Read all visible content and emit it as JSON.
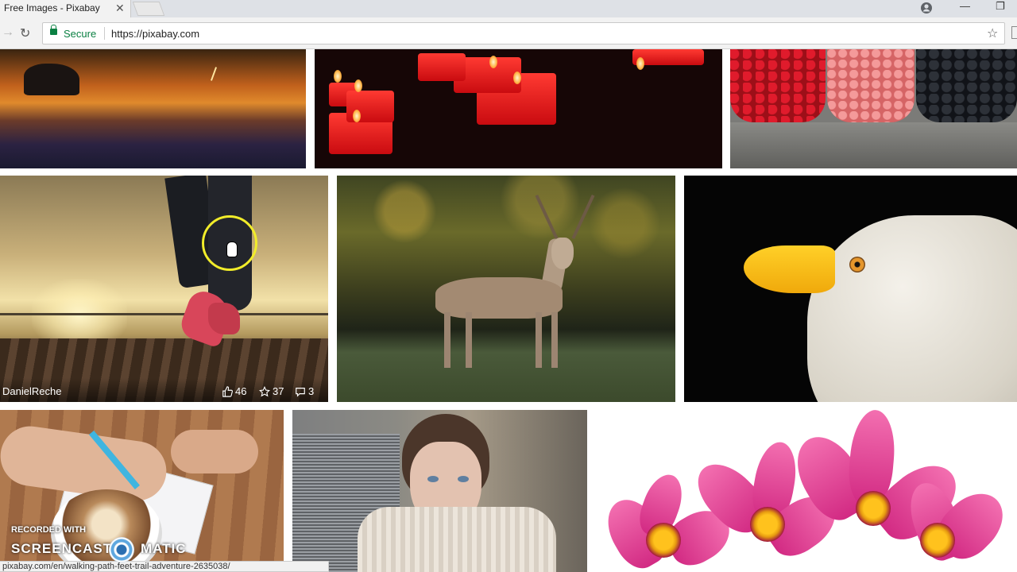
{
  "browser": {
    "tab_title": "Free Images - Pixabay",
    "tab_close": "✕",
    "secure_label": "Secure",
    "url": "https://pixabay.com",
    "status_url": "pixabay.com/en/walking-path-feet-trail-adventure-2635038/"
  },
  "hovered_photo": {
    "author": "DanielReche",
    "likes": "46",
    "favorites": "37",
    "comments": "3"
  },
  "watermark": {
    "line1": "RECORDED WITH",
    "line2a": "SCREENCAST",
    "line2b": "MATIC"
  },
  "colors": {
    "secure_green": "#0b8043",
    "cursor_highlight": "#f1ec2a"
  }
}
